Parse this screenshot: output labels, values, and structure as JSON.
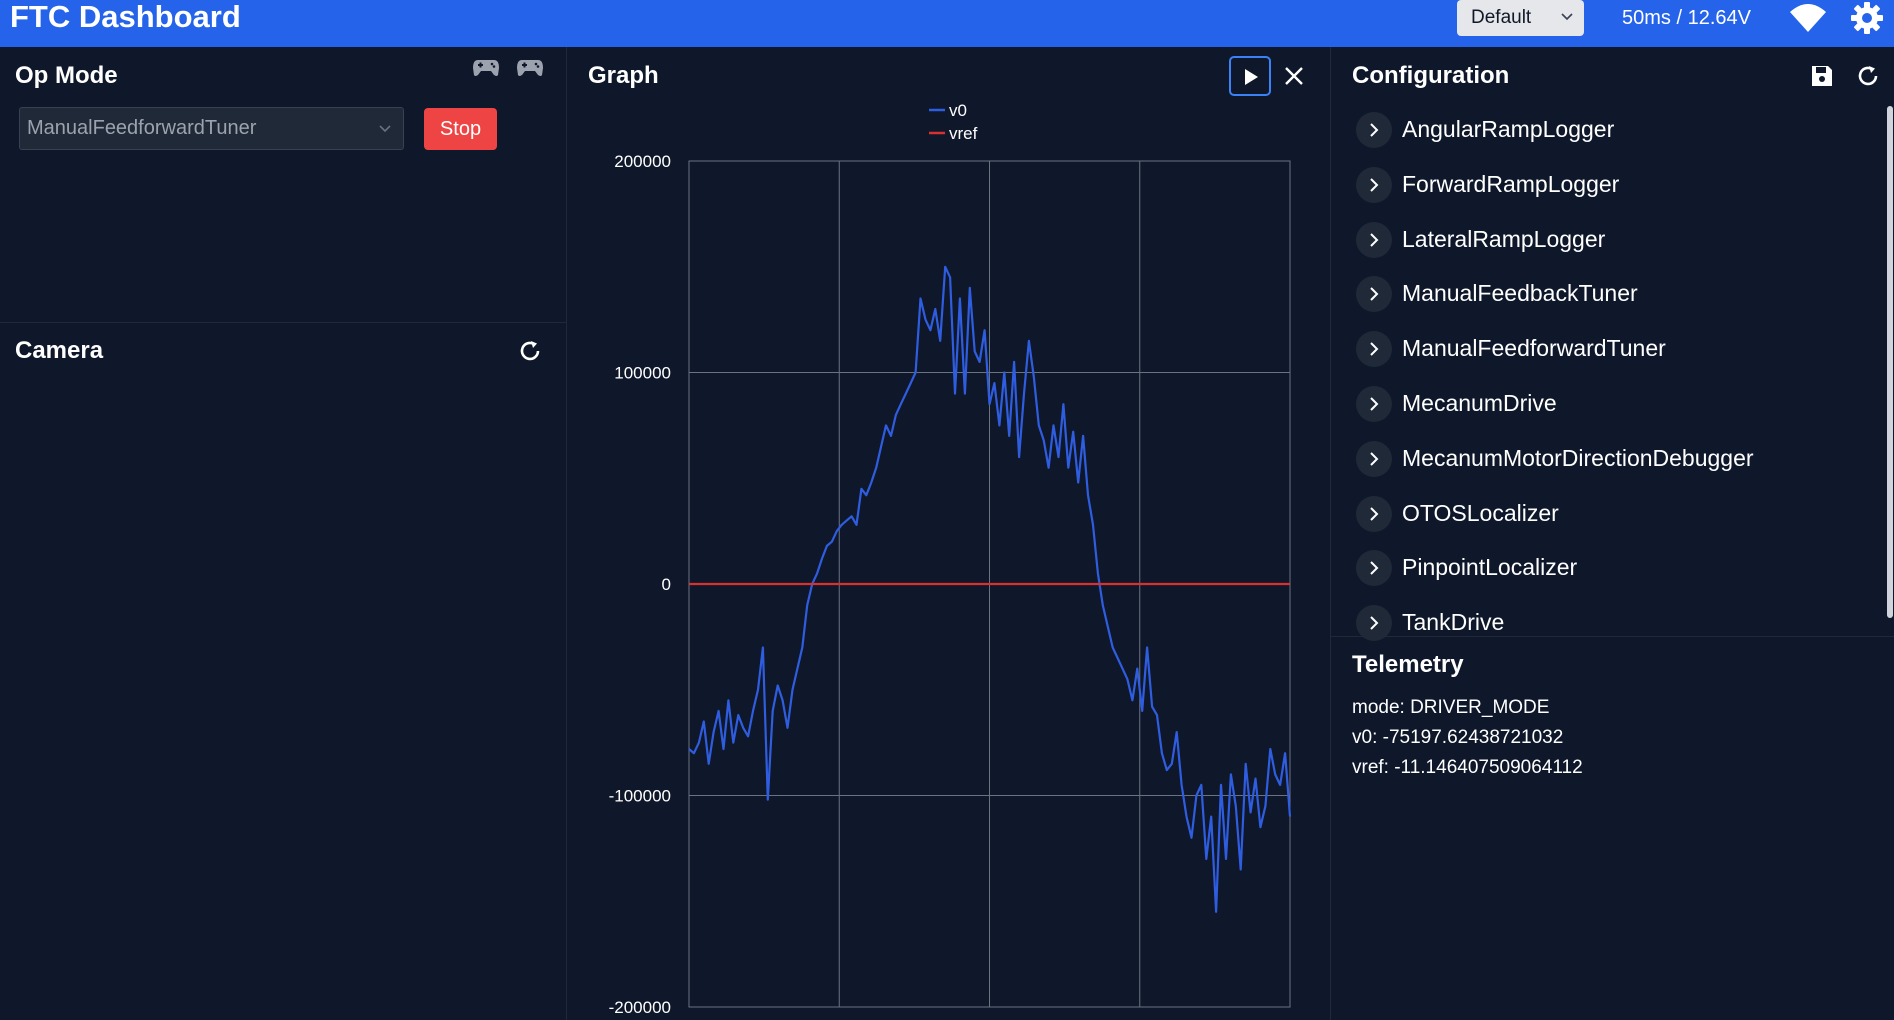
{
  "app": {
    "title": "FTC Dashboard",
    "layout_preset": "Default",
    "status": "50ms / 12.64V"
  },
  "opmode": {
    "title": "Op Mode",
    "selected": "ManualFeedforwardTuner",
    "stop_label": "Stop"
  },
  "camera": {
    "title": "Camera"
  },
  "graph": {
    "title": "Graph"
  },
  "chart_data": {
    "type": "line",
    "title": "",
    "xlabel": "",
    "ylabel": "",
    "ylim": [
      -200000,
      200000
    ],
    "yticks": [
      "200000",
      "100000",
      "0",
      "-100000",
      "-200000"
    ],
    "grid": true,
    "legend_position": "top-center",
    "series": [
      {
        "name": "v0",
        "color": "#2f5de0",
        "values": [
          -78000,
          -80000,
          -75000,
          -65000,
          -85000,
          -70000,
          -60000,
          -78000,
          -55000,
          -75000,
          -62000,
          -68000,
          -72000,
          -60000,
          -50000,
          -30000,
          -102000,
          -60000,
          -48000,
          -55000,
          -68000,
          -50000,
          -40000,
          -30000,
          -10000,
          0,
          5000,
          12000,
          18000,
          20000,
          25000,
          28000,
          30000,
          32000,
          28000,
          45000,
          42000,
          48000,
          55000,
          65000,
          75000,
          70000,
          80000,
          85000,
          90000,
          95000,
          100000,
          135000,
          125000,
          120000,
          130000,
          115000,
          150000,
          145000,
          90000,
          135000,
          90000,
          140000,
          110000,
          105000,
          120000,
          85000,
          95000,
          75000,
          100000,
          70000,
          105000,
          60000,
          90000,
          115000,
          98000,
          75000,
          68000,
          55000,
          75000,
          60000,
          85000,
          55000,
          72000,
          48000,
          70000,
          42000,
          28000,
          5000,
          -10000,
          -20000,
          -30000,
          -35000,
          -40000,
          -45000,
          -55000,
          -40000,
          -60000,
          -30000,
          -58000,
          -62000,
          -80000,
          -88000,
          -85000,
          -70000,
          -95000,
          -110000,
          -120000,
          -100000,
          -95000,
          -130000,
          -110000,
          -155000,
          -95000,
          -130000,
          -90000,
          -105000,
          -135000,
          -85000,
          -108000,
          -92000,
          -115000,
          -105000,
          -78000,
          -90000,
          -95000,
          -80000,
          -110000
        ]
      },
      {
        "name": "vref",
        "color": "#d93030",
        "values": [
          0,
          0
        ]
      }
    ]
  },
  "config": {
    "title": "Configuration",
    "items": [
      "AngularRampLogger",
      "ForwardRampLogger",
      "LateralRampLogger",
      "ManualFeedbackTuner",
      "ManualFeedforwardTuner",
      "MecanumDrive",
      "MecanumMotorDirectionDebugger",
      "OTOSLocalizer",
      "PinpointLocalizer",
      "TankDrive"
    ]
  },
  "telemetry": {
    "title": "Telemetry",
    "lines": [
      "mode: DRIVER_MODE",
      "v0: -75197.62438721032",
      "vref: -11.146407509064112"
    ]
  },
  "icons": {
    "wifi": "wifi-icon",
    "settings": "gear-icon",
    "gamepad": "gamepad-icon",
    "refresh": "refresh-icon",
    "save": "save-icon",
    "play": "play-icon",
    "close": "close-icon",
    "expand": "chevron-right-icon"
  }
}
